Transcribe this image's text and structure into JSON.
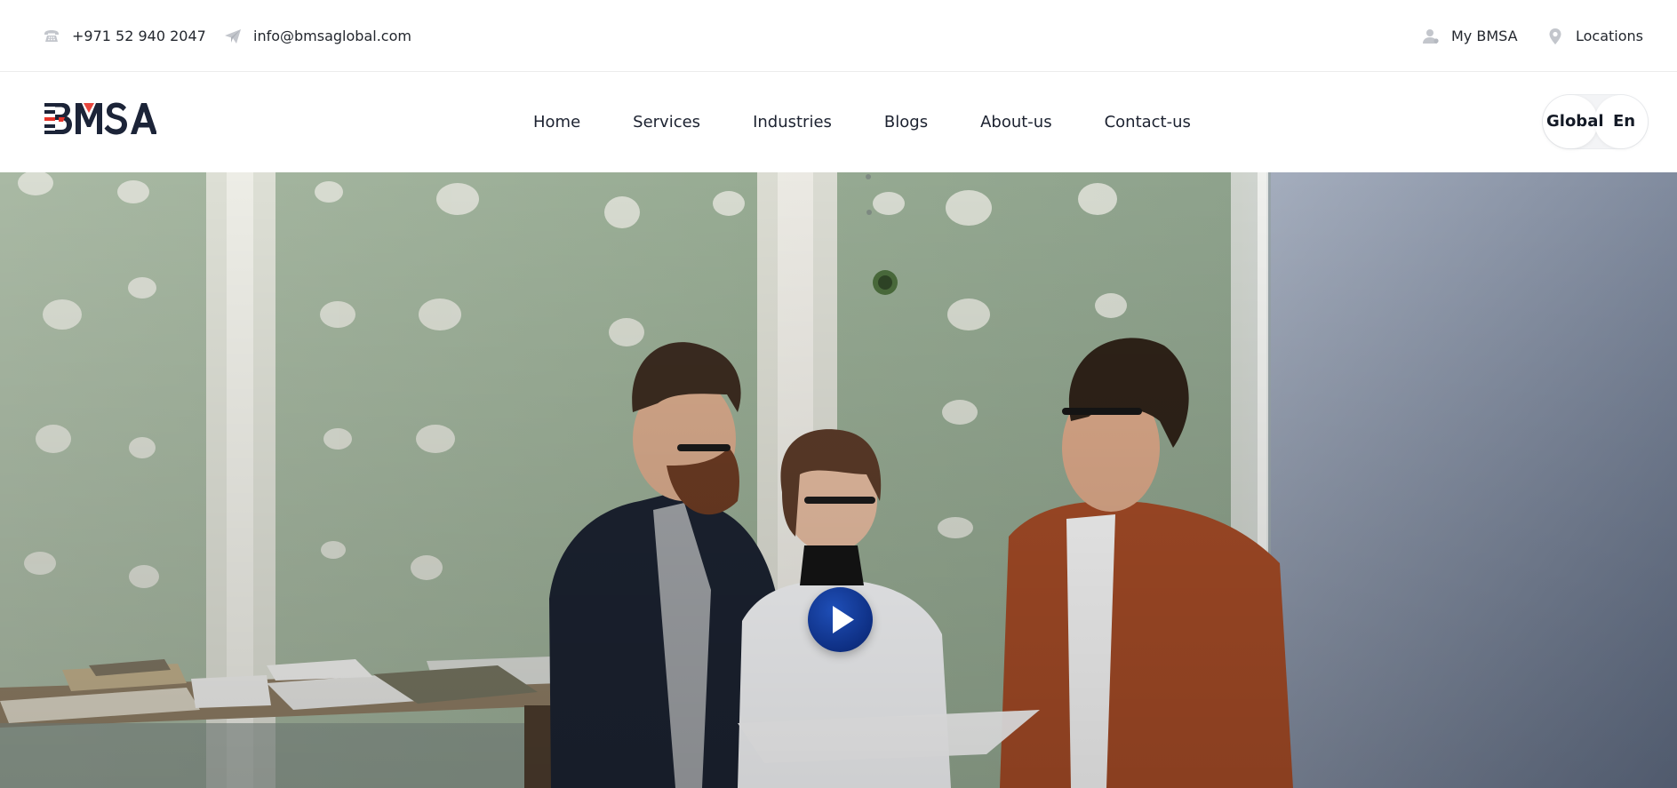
{
  "topbar": {
    "phone": "+971 52 940 2047",
    "email": "info@bmsaglobal.com",
    "my_account": "My BMSA",
    "locations": "Locations"
  },
  "brand": {
    "logo_text": "BMSA",
    "accent_color": "#e63329",
    "dark_color": "#1c2438"
  },
  "nav": {
    "items": [
      {
        "label": "Home"
      },
      {
        "label": "Services"
      },
      {
        "label": "Industries"
      },
      {
        "label": "Blogs"
      },
      {
        "label": "About-us"
      },
      {
        "label": "Contact-us"
      }
    ]
  },
  "language": {
    "region": "Global",
    "lang": "En"
  },
  "hero": {
    "media": "video",
    "play_icon": "play-icon"
  },
  "icons": {
    "phone": "phone-icon",
    "email": "paper-plane-icon",
    "account": "user-icon",
    "location": "map-pin-icon"
  }
}
